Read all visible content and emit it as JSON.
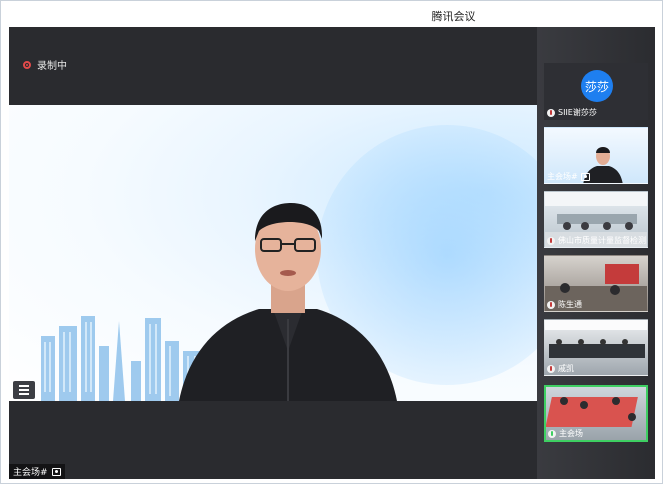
{
  "app": {
    "title": "腾讯会议"
  },
  "main": {
    "recording_label": "录制中",
    "speaker_name": "主会场#"
  },
  "participants": [
    {
      "label": "SIIE谢莎莎",
      "avatar_text": "莎莎",
      "mic": "muted"
    },
    {
      "label": "主会场#",
      "mic": "none"
    },
    {
      "label": "佛山市质量计量监督检测",
      "mic": "muted"
    },
    {
      "label": "陈生通",
      "mic": "muted"
    },
    {
      "label": "戚凯",
      "mic": "muted"
    },
    {
      "label": "主会场",
      "mic": "active"
    }
  ],
  "colors": {
    "active_border": "#3ecf62",
    "record_red": "#e34a4a",
    "avatar_blue": "#1e7ff0"
  }
}
